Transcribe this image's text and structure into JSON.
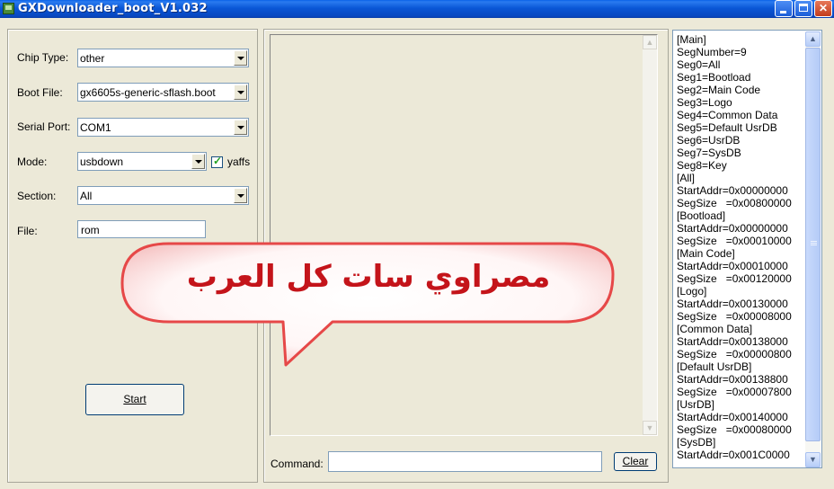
{
  "window": {
    "title": "GXDownloader_boot_V1.032"
  },
  "form": {
    "chip_type": {
      "label": "Chip Type:",
      "value": "other"
    },
    "boot_file": {
      "label": "Boot File:",
      "value": "gx6605s-generic-sflash.boot"
    },
    "serial_port": {
      "label": "Serial Port:",
      "value": "COM1"
    },
    "mode": {
      "label": "Mode:",
      "value": "usbdown",
      "yaffs_label": "yaffs",
      "yaffs_checked": true
    },
    "section": {
      "label": "Section:",
      "value": "All"
    },
    "file": {
      "label": "File:",
      "value": "rom"
    },
    "start_label": "Start"
  },
  "command": {
    "label": "Command:",
    "value": "",
    "clear_label": "Clear"
  },
  "segments": {
    "lines": [
      "[Main]",
      "SegNumber=9",
      "Seg0=All",
      "Seg1=Bootload",
      "Seg2=Main Code",
      "Seg3=Logo",
      "Seg4=Common Data",
      "Seg5=Default UsrDB",
      "Seg6=UsrDB",
      "Seg7=SysDB",
      "Seg8=Key",
      "[All]",
      "StartAddr=0x00000000",
      "SegSize   =0x00800000",
      "[Bootload]",
      "StartAddr=0x00000000",
      "SegSize   =0x00010000",
      "[Main Code]",
      "StartAddr=0x00010000",
      "SegSize   =0x00120000",
      "[Logo]",
      "StartAddr=0x00130000",
      "SegSize   =0x00008000",
      "[Common Data]",
      "StartAddr=0x00138000",
      "SegSize   =0x00000800",
      "[Default UsrDB]",
      "StartAddr=0x00138800",
      "SegSize   =0x00007800",
      "[UsrDB]",
      "StartAddr=0x00140000",
      "SegSize   =0x00080000",
      "[SysDB]",
      "StartAddr=0x001C0000"
    ]
  },
  "overlay": {
    "text": "مصراوي سات كل العرب",
    "color": "#c4141a"
  }
}
